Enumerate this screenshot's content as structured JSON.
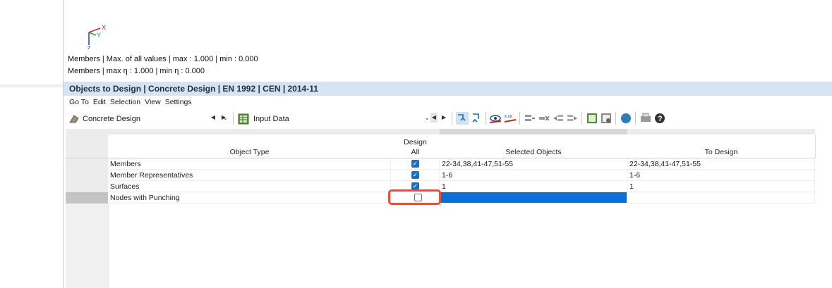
{
  "viewport": {
    "axis_labels": {
      "x": "X",
      "y": "Y",
      "z": "Z"
    },
    "info_line_1": "Members | Max. of all values | max  : 1.000 | min  : 0.000",
    "info_line_2": "Members | max η : 1.000 | min η : 0.000"
  },
  "panel": {
    "title": "Objects to Design | Concrete Design | EN 1992 | CEN | 2014-11"
  },
  "menu": {
    "items": [
      "Go To",
      "Edit",
      "Selection",
      "View",
      "Settings"
    ]
  },
  "toolbar": {
    "module_combo": "Concrete Design",
    "table_combo": "Input Data"
  },
  "table": {
    "headers": {
      "object_type": "Object Type",
      "design_top": "Design",
      "design_bottom": "All",
      "selected_objects": "Selected Objects",
      "to_design": "To Design"
    },
    "rows": [
      {
        "object_type": "Members",
        "design": true,
        "selected": "22-34,38,41-47,51-55",
        "to_design": "22-34,38,41-47,51-55"
      },
      {
        "object_type": "Member Representatives",
        "design": true,
        "selected": "1-6",
        "to_design": "1-6"
      },
      {
        "object_type": "Surfaces",
        "design": true,
        "selected": "1",
        "to_design": "1"
      },
      {
        "object_type": "Nodes with Punching",
        "design": false,
        "selected": "",
        "to_design": ""
      }
    ]
  },
  "colors": {
    "title_bar": "#d6e4f2",
    "selection_blue": "#0a6fd6",
    "checkbox_blue": "#1a6fc4",
    "highlight_red": "#e0533a"
  }
}
